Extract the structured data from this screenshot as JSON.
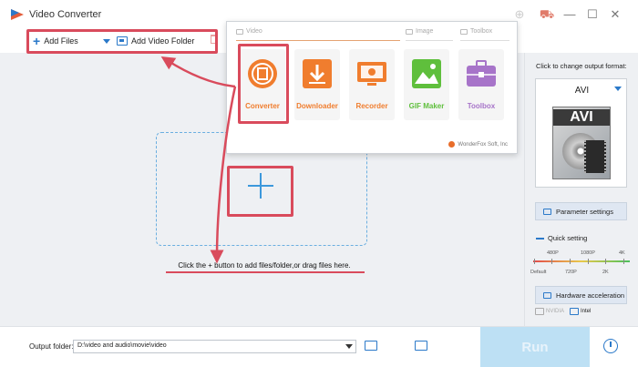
{
  "window": {
    "title": "Video Converter",
    "controls": [
      "minimize",
      "maximize",
      "close"
    ]
  },
  "toolbar": {
    "add_files_label": "Add Files",
    "add_video_folder_label": "Add Video Folder"
  },
  "workarea": {
    "drop_hint": "Click the + button to add files/folder,or drag files here."
  },
  "popup": {
    "categories": {
      "video": "Video",
      "image": "Image",
      "toolbox": "Toolbox"
    },
    "modules": [
      {
        "label": "Converter",
        "icon": "film-converter-icon",
        "color": "#f07d2e"
      },
      {
        "label": "Downloader",
        "icon": "download-arrow-icon",
        "color": "#f07d2e"
      },
      {
        "label": "Recorder",
        "icon": "screen-recorder-icon",
        "color": "#f07d2e"
      },
      {
        "label": "GIF Maker",
        "icon": "gif-image-icon",
        "color": "#5fbf3c"
      },
      {
        "label": "Toolbox",
        "icon": "toolbox-icon",
        "color": "#a774c9"
      }
    ],
    "footer": "WonderFox Soft, Inc"
  },
  "right_panel": {
    "caption": "Click to change output format:",
    "format": "AVI",
    "format_badge": "AVI",
    "parameter_settings": "Parameter settings",
    "quick_setting": "Quick setting",
    "quality_top": [
      "480P",
      "1080P",
      "4K"
    ],
    "quality_bottom": [
      "Default",
      "720P",
      "2K"
    ],
    "hardware_acceleration": "Hardware acceleration",
    "hw_options": [
      {
        "label": "NVIDIA",
        "enabled": false
      },
      {
        "label": "Intel",
        "enabled": true
      }
    ]
  },
  "bottom": {
    "output_folder_label": "Output folder:",
    "output_folder_value": "D:\\video and audio\\movie\\video",
    "run_label": "Run"
  },
  "colors": {
    "accent": "#2b79c9",
    "highlight": "#d94b5c",
    "run_button": "#bde0f4"
  }
}
